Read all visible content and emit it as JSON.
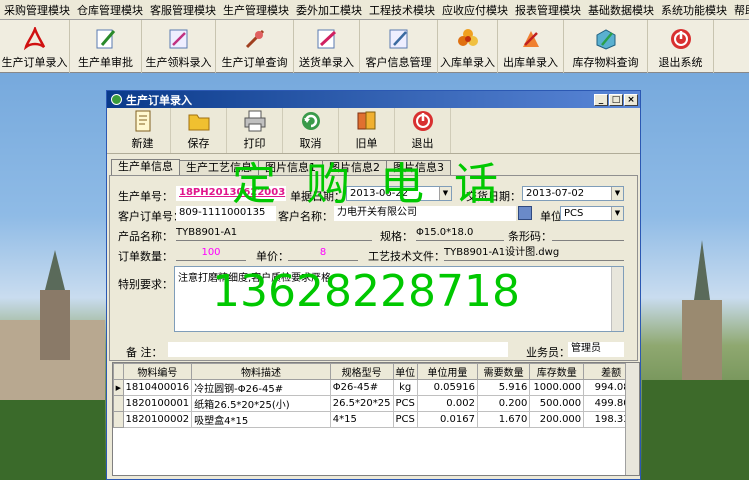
{
  "menu": [
    "采购管理模块",
    "仓库管理模块",
    "客服管理模块",
    "生产管理模块",
    "委外加工模块",
    "工程技术模块",
    "应收应付模块",
    "报表管理模块",
    "基础数据模块",
    "系统功能模块",
    "帮助"
  ],
  "toolbar": [
    {
      "label": "生产订单录入",
      "icon": "pdf-icon"
    },
    {
      "label": "生产单审批",
      "icon": "approve-pen-icon"
    },
    {
      "label": "生产领料录入",
      "icon": "material-icon"
    },
    {
      "label": "生产订单查询",
      "icon": "query-icon"
    },
    {
      "label": "送货单录入",
      "icon": "delivery-icon"
    },
    {
      "label": "客户信息管理",
      "icon": "customer-icon"
    },
    {
      "label": "入库单录入",
      "icon": "inbound-flower-icon"
    },
    {
      "label": "出库单录入",
      "icon": "outbound-icon"
    },
    {
      "label": "库存物料查询",
      "icon": "stock-query-icon"
    },
    {
      "label": "退出系统",
      "icon": "exit-power-icon"
    }
  ],
  "window": {
    "title": "生产订单录入",
    "buttons": [
      {
        "label": "新建",
        "icon": "new-document-icon"
      },
      {
        "label": "保存",
        "icon": "save-folder-icon"
      },
      {
        "label": "打印",
        "icon": "printer-icon"
      },
      {
        "label": "取消",
        "icon": "cancel-arrow-icon"
      },
      {
        "label": "旧单",
        "icon": "old-order-books-icon"
      },
      {
        "label": "退出",
        "icon": "exit-power-icon"
      }
    ],
    "tabs": [
      "生产单信息",
      "生产工艺信息",
      "图片信息1",
      "图片信息2",
      "图片信息3"
    ]
  },
  "form": {
    "order_no_label": "生产单号：",
    "order_no": "18PH20130622003",
    "order_date_label": "单据日期：",
    "order_date": "2013-06-22",
    "delivery_date_label": "交货日期：",
    "delivery_date": "2013-07-02",
    "cust_order_label": "客户订单号：",
    "cust_order": "809-1111000135",
    "customer_label": "客户名称：",
    "customer": "力电开关有限公司",
    "unit_label": "单位：",
    "unit": "PCS",
    "product_label": "产品名称：",
    "product": "TYB8901-A1",
    "spec_label": "规格：",
    "spec": "Φ15.0*18.0",
    "barcode_label": "条形码：",
    "barcode": "",
    "qty_label": "订单数量：",
    "qty": "100",
    "price_label": "单价：",
    "price": "8",
    "craft_label": "工艺技术文件：",
    "craft": "TYB8901-A1设计图.dwg",
    "special_label": "特别要求：",
    "special": "注意打磨精细度,客户质检要求严格",
    "remark_label": "备  注：",
    "remark": "",
    "salesman_label": "业务员：",
    "salesman": "管理员"
  },
  "grid": {
    "columns": [
      "物料编号",
      "物料描述",
      "规格型号",
      "单位",
      "单位用量",
      "需要数量",
      "库存数量",
      "差额"
    ],
    "rows": [
      [
        "1810400016",
        "冷拉圆钢-Φ26-45#",
        "Φ26-45#",
        "kg",
        "0.05916",
        "5.916",
        "1000.000",
        "994.084"
      ],
      [
        "1820100001",
        "纸箱26.5*20*25(小)",
        "26.5*20*25",
        "PCS",
        "0.002",
        "0.200",
        "500.000",
        "499.800"
      ],
      [
        "1820100002",
        "吸塑盒4*15",
        "4*15",
        "PCS",
        "0.0167",
        "1.670",
        "200.000",
        "198.330"
      ]
    ]
  },
  "watermark": {
    "line1": "定 购 电 话",
    "line2": "13628228718"
  },
  "colors": {
    "titlebar": "#0a3a8a",
    "order_no": "#e0158c",
    "qty": "#ff00ff",
    "watermark": "#00c800"
  }
}
